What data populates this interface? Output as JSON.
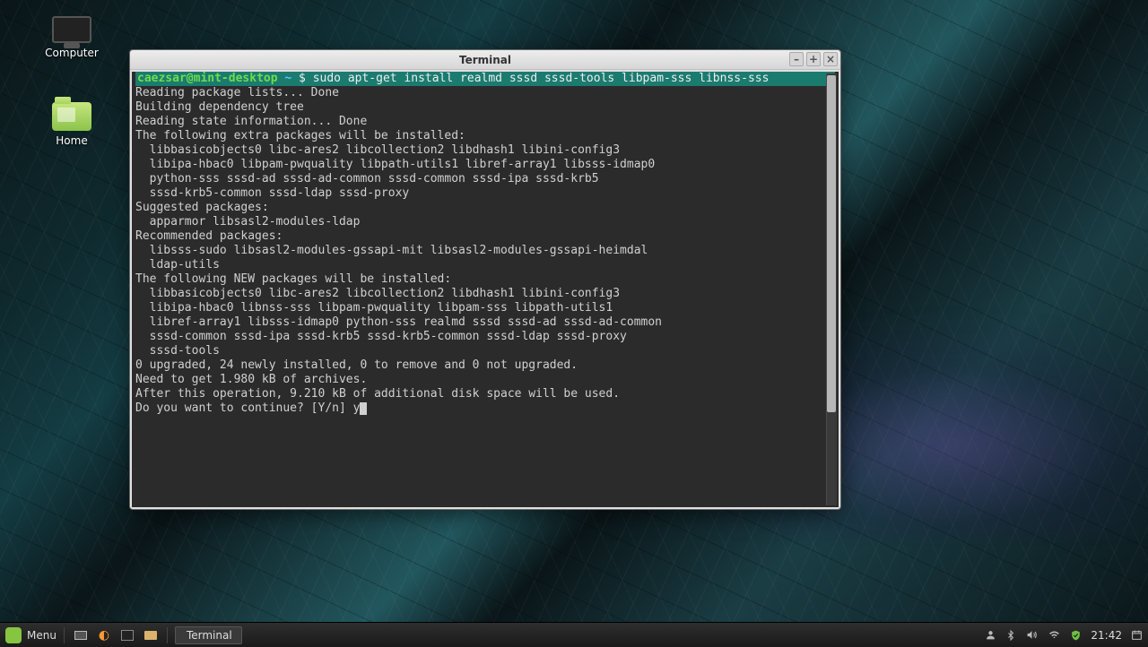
{
  "desktop": {
    "icons": {
      "computer": "Computer",
      "home": "Home"
    }
  },
  "window": {
    "title": "Terminal",
    "buttons": {
      "min": "–",
      "max": "+",
      "close": "×"
    }
  },
  "terminal": {
    "prompt": {
      "user": "caezsar",
      "host": "mint-desktop",
      "cwd": "~",
      "symbol": "$",
      "command": "sudo apt-get install realmd sssd sssd-tools libpam-sss libnss-sss"
    },
    "output": "Reading package lists... Done\nBuilding dependency tree\nReading state information... Done\nThe following extra packages will be installed:\n  libbasicobjects0 libc-ares2 libcollection2 libdhash1 libini-config3\n  libipa-hbac0 libpam-pwquality libpath-utils1 libref-array1 libsss-idmap0\n  python-sss sssd-ad sssd-ad-common sssd-common sssd-ipa sssd-krb5\n  sssd-krb5-common sssd-ldap sssd-proxy\nSuggested packages:\n  apparmor libsasl2-modules-ldap\nRecommended packages:\n  libsss-sudo libsasl2-modules-gssapi-mit libsasl2-modules-gssapi-heimdal\n  ldap-utils\nThe following NEW packages will be installed:\n  libbasicobjects0 libc-ares2 libcollection2 libdhash1 libini-config3\n  libipa-hbac0 libnss-sss libpam-pwquality libpam-sss libpath-utils1\n  libref-array1 libsss-idmap0 python-sss realmd sssd sssd-ad sssd-ad-common\n  sssd-common sssd-ipa sssd-krb5 sssd-krb5-common sssd-ldap sssd-proxy\n  sssd-tools\n0 upgraded, 24 newly installed, 0 to remove and 0 not upgraded.\nNeed to get 1.980 kB of archives.\nAfter this operation, 9.210 kB of additional disk space will be used.",
    "confirm_prefix": "Do you want to continue? [Y/n] ",
    "confirm_input": "y"
  },
  "taskbar": {
    "menu_label": "Menu",
    "active_app": "Terminal",
    "clock": "21:42"
  }
}
